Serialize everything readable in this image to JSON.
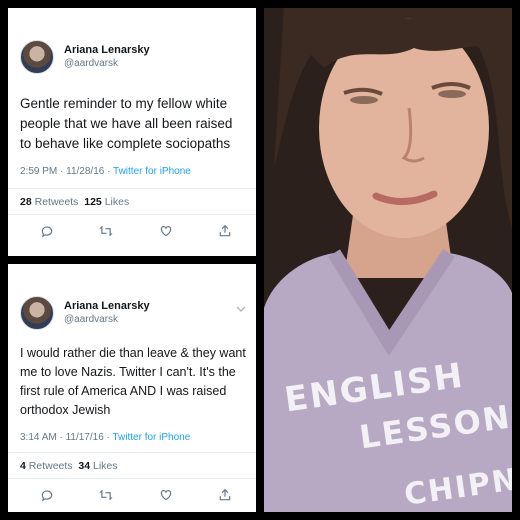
{
  "tweets": [
    {
      "display_name": "Ariana Lenarsky",
      "handle": "@aardvarsk",
      "text": "Gentle reminder to my fellow white people that we have all been raised to behave like complete sociopaths",
      "time": "2:59 PM · 11/28/16 · ",
      "source": "Twitter for iPhone",
      "retweets_count": "28",
      "retweets_label": "Retweets",
      "likes_count": "125",
      "likes_label": "Likes"
    },
    {
      "display_name": "Ariana Lenarsky",
      "handle": "@aardvarsk",
      "text": "I would rather die than leave & they want me to love Nazis. Twitter I can't. It's the first rule of America AND I was raised orthodox Jewish",
      "time": "3:14 AM · 11/17/16 · ",
      "source": "Twitter for iPhone",
      "retweets_count": "4",
      "retweets_label": "Retweets",
      "likes_count": "34",
      "likes_label": "Likes"
    }
  ],
  "photo": {
    "sweater_line1": "ENGLISH",
    "sweater_line2": "LESSON",
    "sweater_line3": "CHIPN"
  },
  "icons": [
    "reply-icon",
    "retweet-icon",
    "like-icon",
    "share-icon",
    "chevron-down-icon"
  ],
  "colors": {
    "link": "#1da1f2",
    "muted": "#657786",
    "sweater": "#b7a9c4"
  }
}
